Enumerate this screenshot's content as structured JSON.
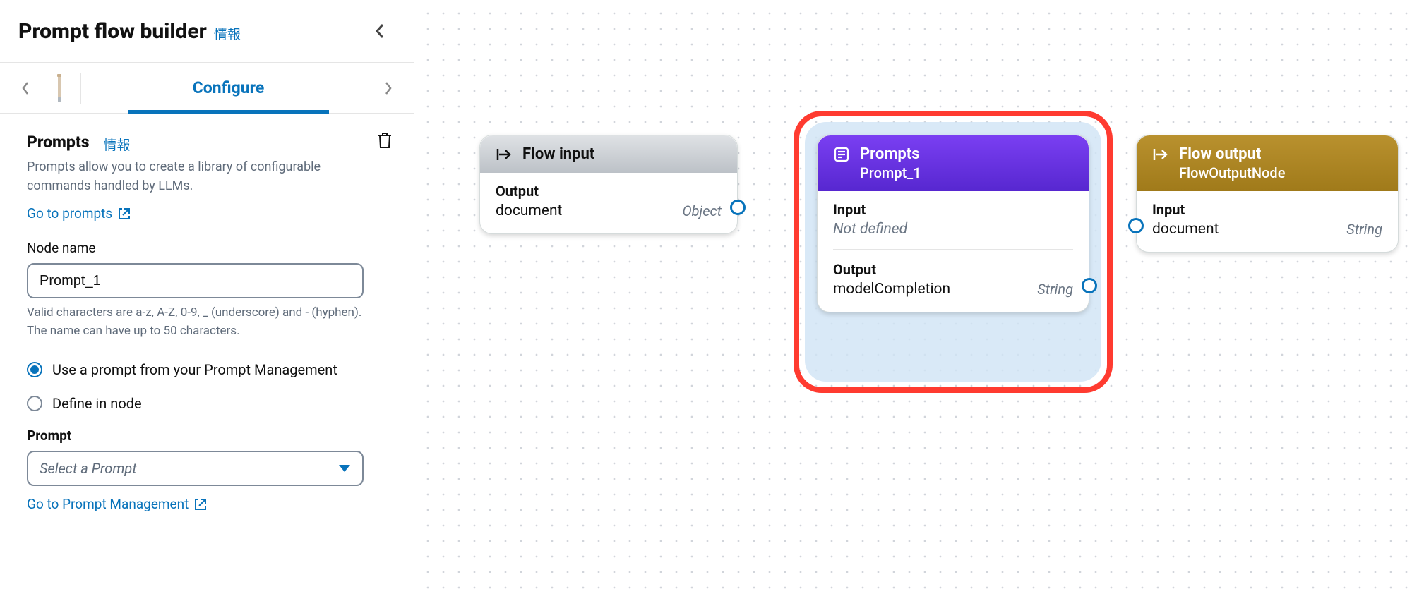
{
  "sidebar": {
    "title": "Prompt flow builder",
    "info_label": "情報",
    "tab_active": "Configure",
    "section": {
      "title": "Prompts",
      "info_label": "情報",
      "description": "Prompts allow you to create a library of configurable commands handled by LLMs.",
      "go_to_prompts": "Go to prompts"
    },
    "node_name": {
      "label": "Node name",
      "value": "Prompt_1",
      "hint": "Valid characters are a-z, A-Z, 0-9, _ (underscore) and - (hyphen). The name can have up to 50 characters."
    },
    "radio": {
      "option_a": "Use a prompt from your Prompt Management",
      "option_b": "Define in node",
      "selected": "a"
    },
    "prompt_select": {
      "label": "Prompt",
      "placeholder": "Select a Prompt",
      "go_to_mgmt": "Go to Prompt Management"
    }
  },
  "canvas": {
    "nodes": {
      "flow_input": {
        "title": "Flow input",
        "output_label": "Output",
        "output_name": "document",
        "output_type": "Object"
      },
      "prompts": {
        "title": "Prompts",
        "subtitle": "Prompt_1",
        "input_label": "Input",
        "input_value": "Not defined",
        "output_label": "Output",
        "output_name": "modelCompletion",
        "output_type": "String"
      },
      "flow_output": {
        "title": "Flow output",
        "subtitle": "FlowOutputNode",
        "input_label": "Input",
        "input_name": "document",
        "input_type": "String"
      }
    }
  }
}
